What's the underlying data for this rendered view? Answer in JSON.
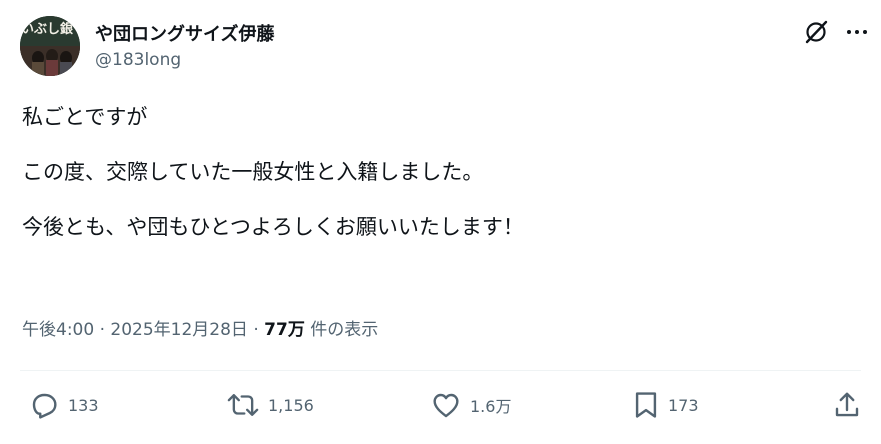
{
  "user": {
    "display_name": "や団ロングサイズ伊藤",
    "handle": "@183long",
    "avatar_text": "いぶし銀"
  },
  "tweet": {
    "lines": [
      "私ごとですが",
      "この度、交際していた一般女性と入籍しました。",
      "今後とも、や団もひとつよろしくお願いいたします！"
    ]
  },
  "meta": {
    "time": "午後4:00",
    "separator": " · ",
    "date": "2025年12月28日",
    "views_count": "77万",
    "views_label": " 件の表示"
  },
  "actions": {
    "replies": "133",
    "reposts": "1,156",
    "likes": "1.6万",
    "bookmarks": "173"
  },
  "icons": {
    "header": [
      "grok-icon",
      "more-icon"
    ],
    "actions": [
      "reply-icon",
      "repost-icon",
      "like-icon",
      "bookmark-icon",
      "share-icon"
    ]
  },
  "colors": {
    "text": "#0f1419",
    "secondary": "#536471",
    "divider": "#eff3f4"
  }
}
